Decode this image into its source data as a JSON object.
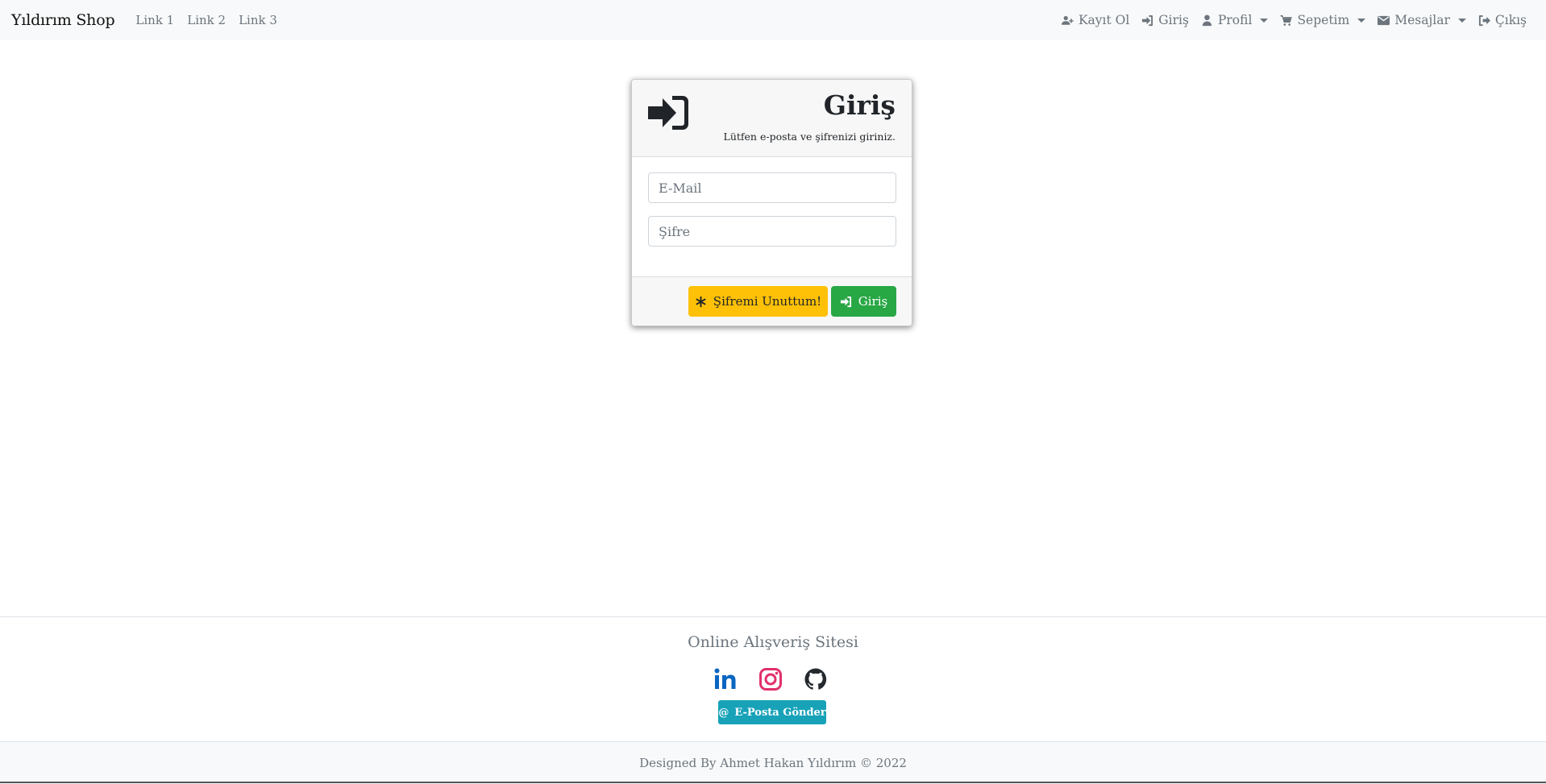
{
  "navbar": {
    "brand": "Yıldırım Shop",
    "links": [
      "Link 1",
      "Link 2",
      "Link 3"
    ],
    "right_items": [
      {
        "label": "Kayıt Ol",
        "icon": "user-plus-icon"
      },
      {
        "label": "Giriş",
        "icon": "sign-in-icon"
      },
      {
        "label": "Profil",
        "icon": "user-icon",
        "dropdown": true
      },
      {
        "label": "Sepetim",
        "icon": "cart-icon",
        "dropdown": true
      },
      {
        "label": "Mesajlar",
        "icon": "envelope-icon",
        "dropdown": true
      },
      {
        "label": "Çıkış",
        "icon": "sign-out-icon"
      }
    ]
  },
  "login_card": {
    "title": "Giriş",
    "subtitle": "Lütfen e-posta ve şifrenizi giriniz.",
    "email_placeholder": "E-Mail",
    "password_placeholder": "Şifre",
    "forgot_button": "Şifremi Unuttum!",
    "login_button": "Giriş"
  },
  "footer": {
    "title": "Online Alışveriş Sitesi",
    "social_icons": [
      "linkedin-icon",
      "instagram-icon",
      "github-icon"
    ],
    "email_button": "E-Posta Gönder",
    "copyright": "Designed By Ahmet Hakan Yıldırım © 2022"
  },
  "colors": {
    "navbar_bg": "#f8f9fa",
    "warning": "#ffc107",
    "success": "#28a745",
    "info": "#17a2b8",
    "linkedin": "#0a66c2",
    "instagram": "#e1306c",
    "github": "#24292e"
  }
}
